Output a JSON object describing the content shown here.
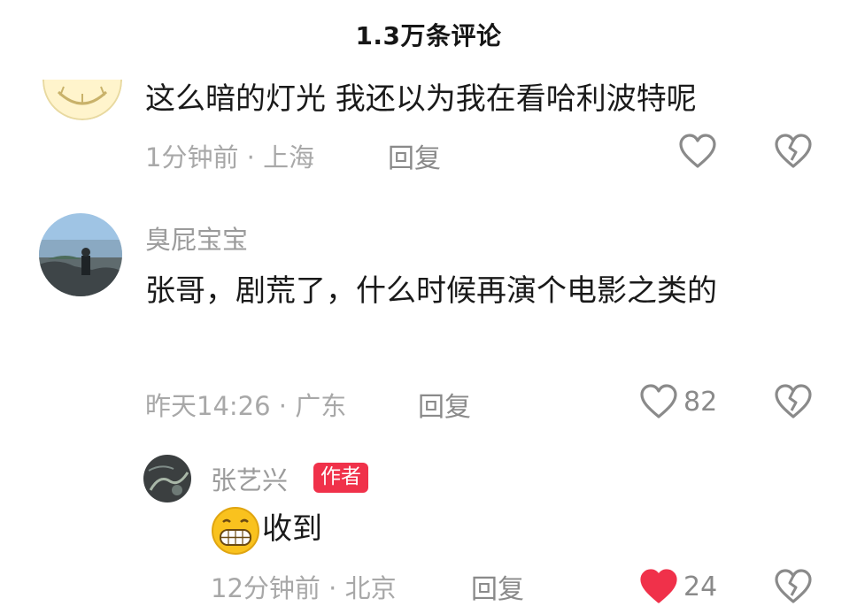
{
  "header": {
    "title": "1.3万条评论"
  },
  "comments": [
    {
      "text": "这么暗的灯光 我还以为我在看哈利波特呢",
      "time": "1分钟前",
      "location": "上海",
      "reply_label": "回复",
      "like_icon": "heart-outline-icon",
      "dislike_icon": "broken-heart-icon"
    },
    {
      "username": "臭屁宝宝",
      "text": "张哥，剧荒了，什么时候再演个电影之类的",
      "time": "昨天14:26",
      "location": "广东",
      "reply_label": "回复",
      "like_count": "82",
      "like_icon": "heart-outline-icon",
      "dislike_icon": "broken-heart-icon"
    }
  ],
  "reply": {
    "username": "张艺兴",
    "badge": "作者",
    "text": "收到",
    "emoji": "grinning-face-emoji",
    "time": "12分钟前",
    "location": "北京",
    "reply_label": "回复",
    "like_count": "24",
    "like_icon": "heart-filled-icon",
    "dislike_icon": "broken-heart-icon",
    "accent_color": "#f0314a"
  },
  "colors": {
    "meta_text": "#a8a8a8",
    "name_text": "#9b9b9b",
    "badge_bg": "#f0314a"
  }
}
